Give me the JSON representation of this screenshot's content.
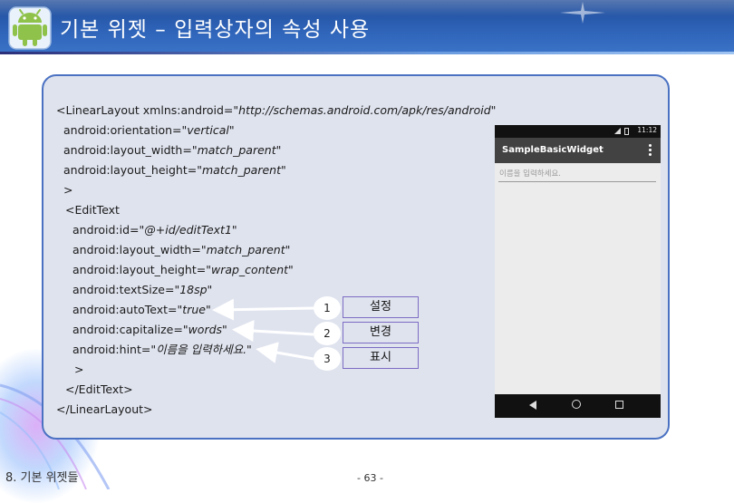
{
  "header": {
    "title": "기본 위젯 – 입력상자의 속성 사용",
    "logo_icon": "android-robot-icon"
  },
  "code": {
    "lines": [
      "<LinearLayout xmlns:android=",
      "\"http://schemas.android.com/apk/res/android\"",
      "android:orientation=",
      "\"vertical\"",
      "android:layout_width=",
      "\"match_parent\"",
      "android:layout_height=",
      "\"match_parent\"",
      ">",
      "<EditText",
      "android:id=",
      "\"@+id/editText1\"",
      "android:layout_width=",
      "\"match_parent\"",
      "android:layout_height=",
      "\"wrap_content\"",
      "android:textSize=",
      "\"18sp\"",
      "android:autoText=",
      "\"true\"",
      "android:capitalize=",
      "\"words\"",
      "android:hint=",
      "\"이름을 입력하세요.\"",
      ">",
      "</EditText>",
      "</LinearLayout>"
    ]
  },
  "phone": {
    "status_time": "11:12",
    "app_title": "SampleBasicWidget",
    "hint": "이름을 입력하세요."
  },
  "callouts": [
    {
      "num": "1",
      "label": "설정"
    },
    {
      "num": "2",
      "label": "변경"
    },
    {
      "num": "3",
      "label": "표시"
    }
  ],
  "footer": {
    "section": "8. 기본 위젯들",
    "page": "- 63 -"
  },
  "colors": {
    "header": "#2e63b8",
    "panel": "#dfe3ee",
    "panel_border": "#4b72c2",
    "label_border": "#7d6cc4"
  }
}
